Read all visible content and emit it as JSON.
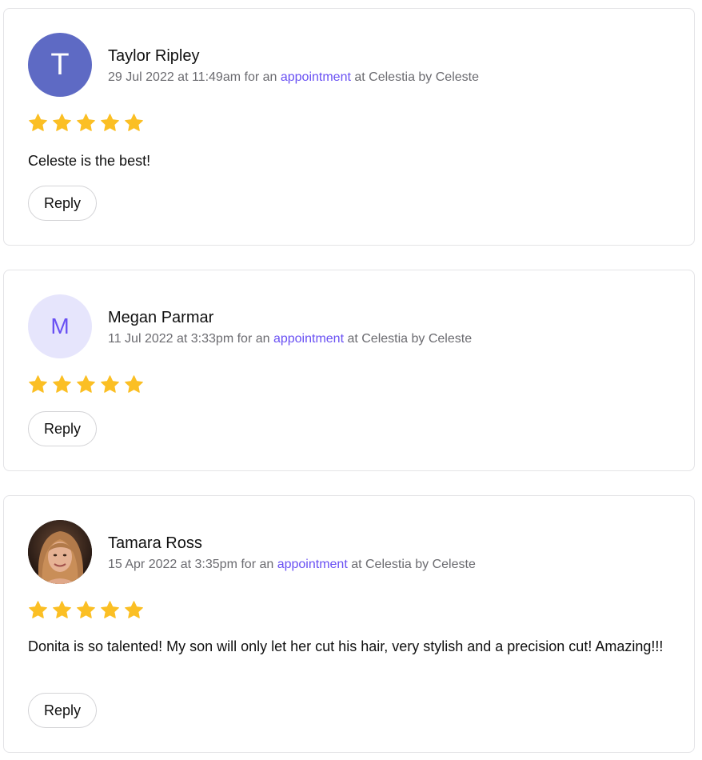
{
  "reviews": [
    {
      "name": "Taylor Ripley",
      "avatar": {
        "type": "letter",
        "letter": "T",
        "bg": "#5e6ac4",
        "fg": "#ffffff"
      },
      "meta_prefix": "29 Jul 2022 at 11:49am for an ",
      "meta_link": "appointment",
      "meta_suffix": " at Celestia by Celeste",
      "rating": 5,
      "text": "Celeste is the best!",
      "reply_label": "Reply"
    },
    {
      "name": "Megan Parmar",
      "avatar": {
        "type": "letter",
        "letter": "M",
        "bg": "#e6e5fc",
        "fg": "#6950f3"
      },
      "meta_prefix": "11 Jul 2022 at 3:33pm for an ",
      "meta_link": "appointment",
      "meta_suffix": " at Celestia by Celeste",
      "rating": 5,
      "text": "",
      "reply_label": "Reply"
    },
    {
      "name": "Tamara Ross",
      "avatar": {
        "type": "photo"
      },
      "meta_prefix": "15 Apr 2022 at 3:35pm for an ",
      "meta_link": "appointment",
      "meta_suffix": " at Celestia by Celeste",
      "rating": 5,
      "text": "Donita is so talented! My son will only let her cut his hair, very stylish and a precision cut! Amazing!!!",
      "reply_label": "Reply"
    }
  ],
  "colors": {
    "star": "#fbbf24",
    "link": "#6950f3",
    "border": "#e3e3e6"
  }
}
